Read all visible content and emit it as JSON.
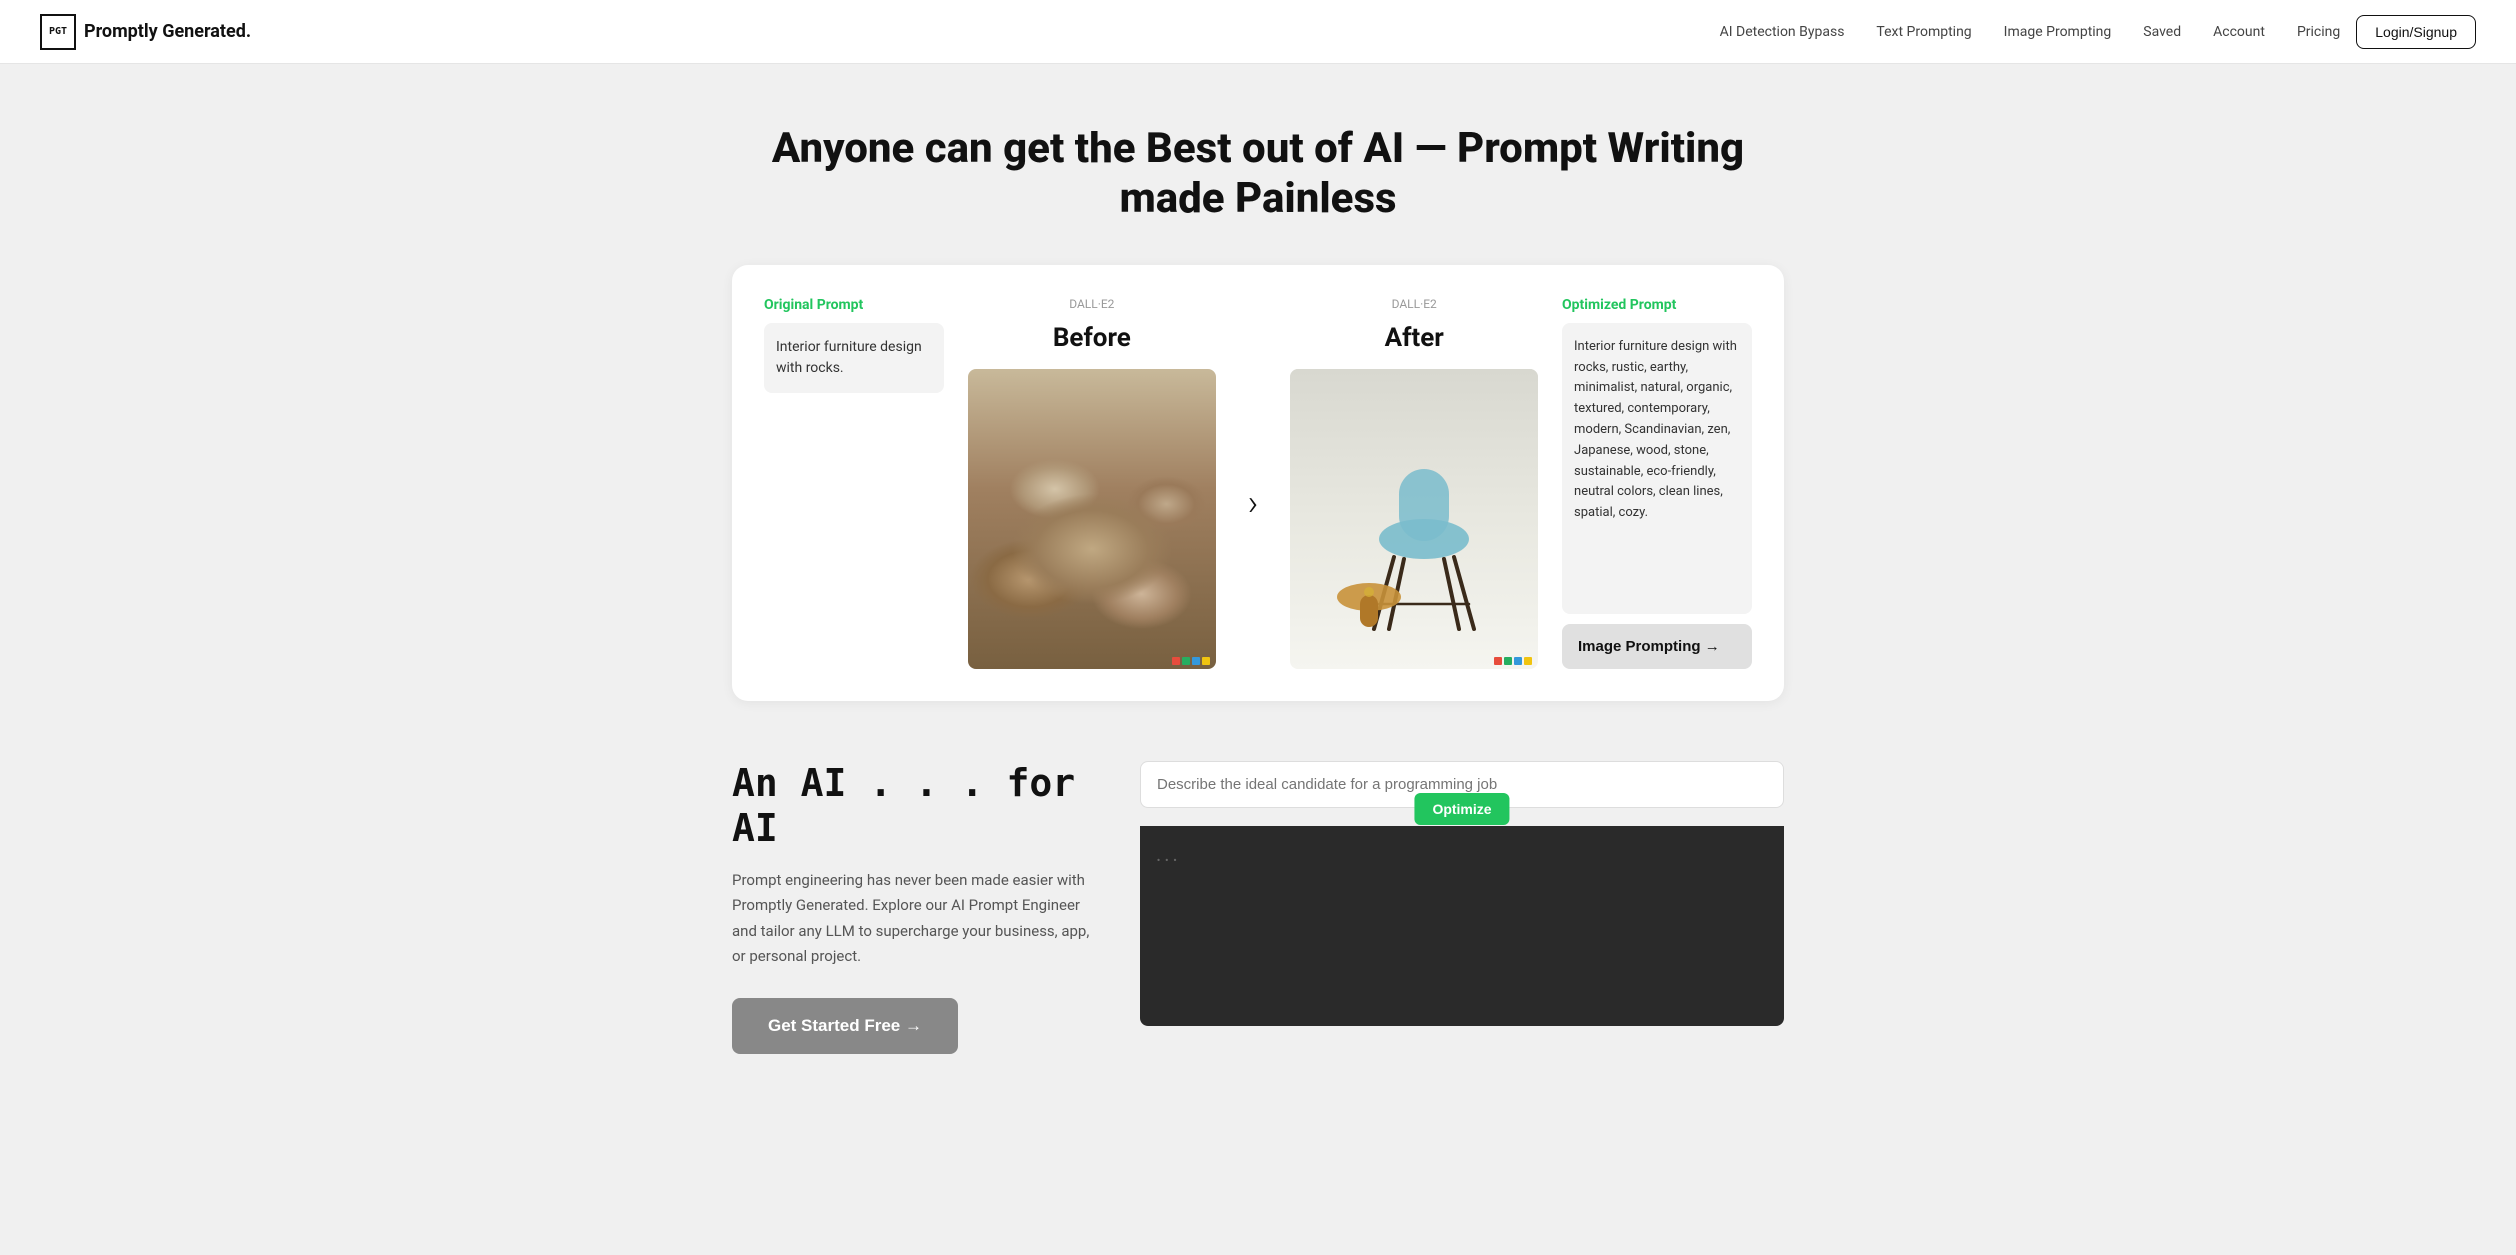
{
  "brand": {
    "logo_text": "PGT",
    "logo_label": "Promptly Generated.",
    "tagline": "Promptly Generated."
  },
  "navbar": {
    "links": [
      {
        "id": "ai-detection-bypass",
        "label": "AI Detection Bypass",
        "href": "#"
      },
      {
        "id": "text-prompting",
        "label": "Text Prompting",
        "href": "#"
      },
      {
        "id": "image-prompting",
        "label": "Image Prompting",
        "href": "#"
      },
      {
        "id": "saved",
        "label": "Saved",
        "href": "#"
      },
      {
        "id": "account",
        "label": "Account",
        "href": "#"
      },
      {
        "id": "pricing",
        "label": "Pricing",
        "href": "#"
      }
    ],
    "login_label": "Login/Signup"
  },
  "hero": {
    "title": "Anyone can get the Best out of AI — Prompt Writing made Painless"
  },
  "comparison": {
    "original_label": "Original Prompt",
    "original_text": "Interior furniture design with rocks.",
    "before_label": "Before",
    "after_label": "After",
    "dall_e_label": "DALL·E2",
    "optimized_label": "Optimized Prompt",
    "optimized_text": "Interior furniture design with rocks, rustic, earthy, minimalist, natural, organic, textured, contemporary, modern, Scandinavian, zen, Japanese, wood, stone, sustainable, eco-friendly, neutral colors, clean lines, spatial, cozy.",
    "image_prompting_btn": "Image Prompting →"
  },
  "bottom": {
    "ai_title": "An AI . . . for AI",
    "description": "Prompt engineering has never been made easier with Promptly Generated. Explore our AI Prompt Engineer and tailor any LLM to supercharge your business, app, or personal project.",
    "cta_label": "Get Started Free →",
    "demo_placeholder": "Describe the ideal candidate for a programming job",
    "optimize_label": "Optimize",
    "demo_dots": "..."
  },
  "colors": {
    "green": "#22c55e",
    "dark": "#111111",
    "gray_btn": "#888888",
    "light_bg": "#f0f0f0"
  }
}
